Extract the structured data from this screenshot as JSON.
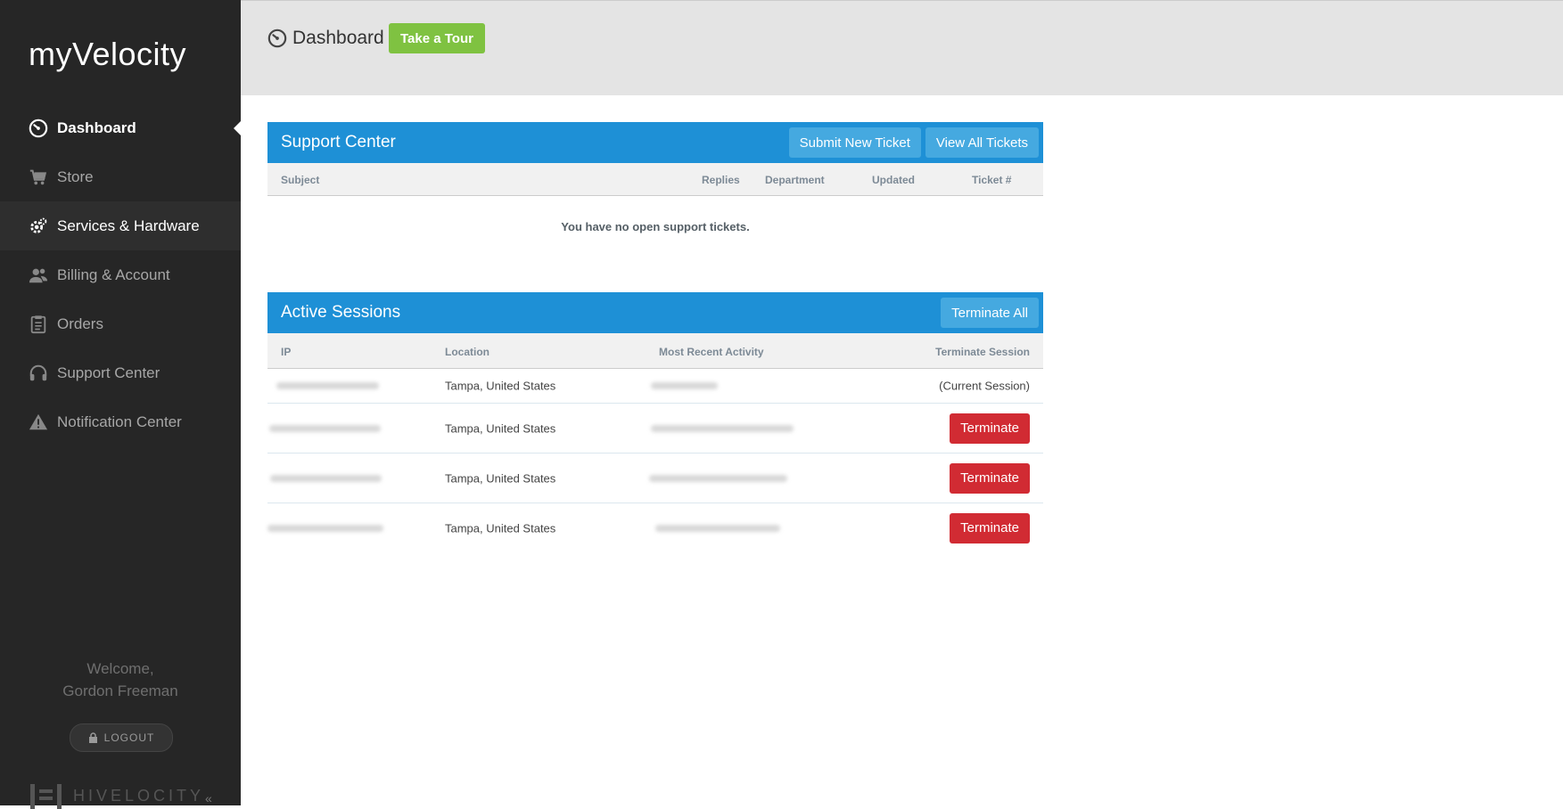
{
  "sidebar": {
    "brand": "myVelocity",
    "items": [
      {
        "label": "Dashboard",
        "icon": "dashboard-icon"
      },
      {
        "label": "Store",
        "icon": "cart-icon"
      },
      {
        "label": "Services & Hardware",
        "icon": "gear-icon"
      },
      {
        "label": "Billing & Account",
        "icon": "users-icon"
      },
      {
        "label": "Orders",
        "icon": "clipboard-icon"
      },
      {
        "label": "Support Center",
        "icon": "headset-icon"
      },
      {
        "label": "Notification Center",
        "icon": "warning-icon"
      }
    ],
    "welcome_line1": "Welcome,",
    "welcome_line2": "Gordon Freeman",
    "logout_label": "LOGOUT",
    "footer_brand": "HIVELOCITY",
    "collapse_glyph": "«"
  },
  "header": {
    "title": "Dashboard",
    "tour_label": "Take a Tour"
  },
  "support": {
    "title": "Support Center",
    "submit_label": "Submit New Ticket",
    "view_label": "View All Tickets",
    "columns": [
      "Subject",
      "Replies",
      "Department",
      "Updated",
      "Ticket #"
    ],
    "empty_message": "You have no open support tickets."
  },
  "sessions": {
    "title": "Active Sessions",
    "terminate_all_label": "Terminate All",
    "columns": [
      "IP",
      "Location",
      "Most Recent Activity",
      "Terminate Session"
    ],
    "rows": [
      {
        "location": "Tampa, United States",
        "action": "(Current Session)"
      },
      {
        "location": "Tampa, United States",
        "action": "Terminate"
      },
      {
        "location": "Tampa, United States",
        "action": "Terminate"
      },
      {
        "location": "Tampa, United States",
        "action": "Terminate"
      }
    ]
  },
  "colors": {
    "sidebar_bg": "#262626",
    "panel_header": "#1e90d6",
    "tour_green": "#7fc241",
    "terminate_red": "#d12b33"
  }
}
